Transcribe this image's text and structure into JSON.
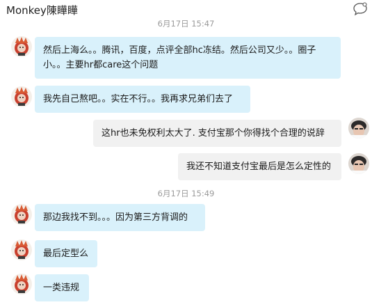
{
  "header": {
    "title": "Monkey陳瞱瞱",
    "icon": "chat-bubble-icon"
  },
  "messages": {
    "timestamp_top": "6月17日  15:47",
    "timestamp_mid": "6月17日  15:49",
    "items": [
      {
        "direction": "in",
        "text": "然后上海么。。腾讯，百度，点评全部hc冻结。然后公司又少。。圈子小。。主要hr都care这个问题"
      },
      {
        "direction": "in",
        "text": "我先自己熬吧。。实在不行。。我再求兄弟们去了"
      },
      {
        "direction": "out",
        "text": "这hr也未免权利太大了.  支付宝那个你得找个合理的说辞"
      },
      {
        "direction": "out",
        "text": "我还不知道支付宝最后是怎么定性的"
      },
      {
        "direction": "in",
        "text": "那边我找不到。。。因为第三方背调的"
      },
      {
        "direction": "in",
        "text": "最后定型么"
      },
      {
        "direction": "in",
        "text": "一类违规"
      }
    ]
  },
  "colors": {
    "incoming_bubble": "#d9f1fb",
    "outgoing_bubble": "#f1f1f1",
    "timestamp": "#9b9b9b"
  }
}
